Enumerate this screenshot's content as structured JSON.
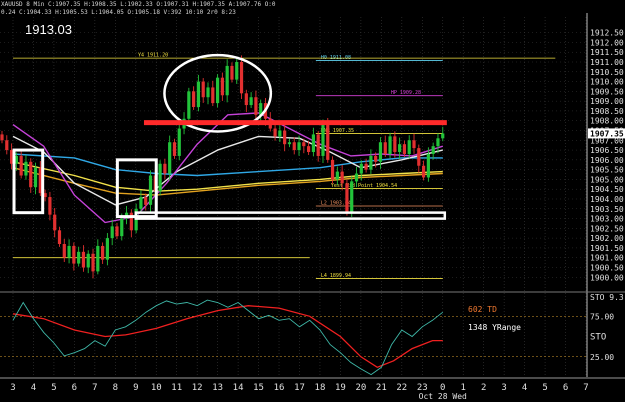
{
  "header": {
    "line1": "XAUUSD 8 Min C:1907.35 H:1908.35 L:1902.33 O:1907.31 H:1907.35 A:1907.76 O:0",
    "line2": "0.24 C:1904.33 H:1905.53 L:1904.05 O:1905.18 V:392 10:10 2r0 8:23"
  },
  "big_price": "1913.03",
  "theme": {
    "bg": "#000000",
    "grid": "#3a3a3a",
    "bull": "#22c33a",
    "bear": "#e23030",
    "axis_text": "#e0e0e0",
    "highlight_label": "#ffffff",
    "red_line": "#ff2a2a"
  },
  "chart_data": [
    {
      "type": "candlestick",
      "panel": "price",
      "ylim": [
        1899.4,
        1913.3
      ],
      "y_ticks": [
        "1912.50",
        "1912.00",
        "1911.50",
        "1911.00",
        "1910.50",
        "1910.00",
        "1909.50",
        "1909.00",
        "1908.50",
        "1908.00",
        "1907.50",
        "1907.00",
        "1906.50",
        "1906.00",
        "1905.50",
        "1905.00",
        "1904.50",
        "1904.00",
        "1903.50",
        "1903.00",
        "1902.50",
        "1902.00",
        "1901.50",
        "1901.00",
        "1900.50",
        "1900.00"
      ],
      "y_tick_values": [
        1912.5,
        1912,
        1911.5,
        1911,
        1910.5,
        1910,
        1909.5,
        1909,
        1908.5,
        1908,
        1907.5,
        1907,
        1906.5,
        1906,
        1905.5,
        1905,
        1904.5,
        1904,
        1903.5,
        1903,
        1902.5,
        1902,
        1901.5,
        1901,
        1900.5,
        1900
      ],
      "last_price": "1907.35",
      "x_ticks": [
        "3",
        "4",
        "5",
        "6",
        "7",
        "8",
        "9",
        "10",
        "11",
        "12",
        "13",
        "14",
        "15",
        "16",
        "17",
        "18",
        "19",
        "20",
        "21",
        "22",
        "23",
        "0",
        "1",
        "2",
        "3",
        "4",
        "5",
        "6",
        "7"
      ],
      "x_tick_values": [
        0,
        1,
        2,
        3,
        4,
        5,
        6,
        7,
        8,
        9,
        10,
        11,
        12,
        13,
        14,
        15,
        16,
        17,
        18,
        19,
        20,
        21,
        22,
        23,
        24,
        25,
        26,
        27,
        28
      ],
      "x_date_label": "Oct 28 Wed",
      "closes": [
        1907.0,
        1906.5,
        1905.8,
        1906.2,
        1905.2,
        1905.9,
        1904.6,
        1905.6,
        1904.3,
        1904.1,
        1903.2,
        1902.4,
        1901.7,
        1901.0,
        1901.6,
        1900.7,
        1901.3,
        1900.5,
        1901.2,
        1900.3,
        1901.6,
        1900.9,
        1902.0,
        1902.6,
        1902.1,
        1903.0,
        1903.3,
        1902.4,
        1903.5,
        1904.1,
        1903.7,
        1905.2,
        1904.4,
        1905.8,
        1905.3,
        1906.9,
        1906.2,
        1907.6,
        1908.1,
        1909.5,
        1908.7,
        1910.0,
        1909.2,
        1909.7,
        1908.9,
        1910.2,
        1909.3,
        1910.8,
        1910.1,
        1911.0,
        1909.4,
        1908.8,
        1909.2,
        1908.3,
        1908.9,
        1908.1,
        1907.6,
        1907.2,
        1907.5,
        1906.8,
        1906.9,
        1906.5,
        1906.9,
        1906.7,
        1906.4,
        1907.3,
        1906.2,
        1907.8,
        1906.0,
        1905.0,
        1905.4,
        1904.8,
        1903.3,
        1904.9,
        1905.3,
        1905.8,
        1905.5,
        1906.2,
        1905.9,
        1906.9,
        1906.3,
        1907.2,
        1906.4,
        1906.8,
        1906.3,
        1907.0,
        1906.6,
        1905.7,
        1905.1,
        1906.3,
        1906.7,
        1907.1,
        1907.35
      ],
      "lines": [
        {
          "name": "blue_ma",
          "color": "#2fa8e6",
          "points": [
            [
              0,
              1906.3
            ],
            [
              3,
              1906.1
            ],
            [
              5,
              1905.5
            ],
            [
              7,
              1905.3
            ],
            [
              9,
              1905.2
            ],
            [
              12,
              1905.4
            ],
            [
              15,
              1905.6
            ],
            [
              17,
              1905.9
            ],
            [
              19,
              1906.1
            ],
            [
              21,
              1906.1
            ]
          ]
        },
        {
          "name": "orange_ma",
          "color": "#e3a21f",
          "points": [
            [
              0,
              1905.6
            ],
            [
              3,
              1904.8
            ],
            [
              5,
              1904.3
            ],
            [
              7,
              1904.2
            ],
            [
              9,
              1904.4
            ],
            [
              12,
              1904.7
            ],
            [
              15,
              1904.9
            ],
            [
              17,
              1905.1
            ],
            [
              19,
              1905.2
            ],
            [
              21,
              1905.3
            ]
          ]
        },
        {
          "name": "yellow_ma",
          "color": "#f2e24a",
          "points": [
            [
              0,
              1905.9
            ],
            [
              3,
              1905.2
            ],
            [
              5,
              1904.6
            ],
            [
              7,
              1904.4
            ],
            [
              9,
              1904.5
            ],
            [
              12,
              1904.8
            ],
            [
              15,
              1905.0
            ],
            [
              17,
              1905.2
            ],
            [
              19,
              1905.3
            ],
            [
              21,
              1905.4
            ]
          ]
        },
        {
          "name": "white_ma",
          "color": "#e8e8e8",
          "points": [
            [
              0,
              1907.2
            ],
            [
              1.5,
              1906.4
            ],
            [
              3,
              1904.8
            ],
            [
              5,
              1903.7
            ],
            [
              6.5,
              1904.1
            ],
            [
              8,
              1905.4
            ],
            [
              10,
              1906.5
            ],
            [
              12,
              1907.2
            ],
            [
              14,
              1907.1
            ],
            [
              15.5,
              1906.4
            ],
            [
              17,
              1905.6
            ],
            [
              19,
              1906.0
            ],
            [
              21,
              1906.5
            ]
          ]
        },
        {
          "name": "magenta_ma",
          "color": "#c542d8",
          "points": [
            [
              0,
              1907.8
            ],
            [
              1.5,
              1906.7
            ],
            [
              3,
              1904.2
            ],
            [
              4.5,
              1902.8
            ],
            [
              6,
              1903.1
            ],
            [
              7.5,
              1904.8
            ],
            [
              9,
              1906.8
            ],
            [
              10.5,
              1908.3
            ],
            [
              12,
              1908.4
            ],
            [
              13.5,
              1907.6
            ],
            [
              15,
              1906.8
            ],
            [
              16.5,
              1906.2
            ],
            [
              18,
              1906.3
            ],
            [
              19.5,
              1906.2
            ],
            [
              21,
              1906.7
            ]
          ]
        }
      ],
      "levels": [
        {
          "label": "H0 1911.08",
          "value": 1911.08,
          "color": "#5fd2f0",
          "x_from": 14.8,
          "x_to": 21
        },
        {
          "label": "Y4 1911.20",
          "value": 1911.2,
          "color": "#f0e040",
          "x_from": 0,
          "x_to": 26.5
        },
        {
          "label": "HP 1909.28",
          "value": 1909.28,
          "color": "#d640d8",
          "x_from": 14.8,
          "x_to": 21
        },
        {
          "label": "RNR 1907.35",
          "value": 1907.35,
          "color": "#f0e040",
          "x_from": 14.8,
          "x_to": 21
        },
        {
          "label": "Yest Mid Point 1904.54",
          "value": 1904.54,
          "color": "#f0e040",
          "x_from": 14.8,
          "x_to": 21
        },
        {
          "label": "L2 1903.64",
          "value": 1903.64,
          "color": "#f09060",
          "x_from": 14.8,
          "x_to": 21
        },
        {
          "label": "",
          "value": 1901.0,
          "color": "#f0e040",
          "x_from": 0,
          "x_to": 14.5
        },
        {
          "label": "L4 1899.94",
          "value": 1899.94,
          "color": "#f0e040",
          "x_from": 14.8,
          "x_to": 21
        }
      ]
    },
    {
      "type": "line",
      "panel": "oscillator",
      "ylim": [
        0,
        100
      ],
      "y_ticks": [
        "STO 9.3",
        "25.00",
        "75.00"
      ],
      "y_tick_values": [
        100,
        25,
        75
      ],
      "labels": [
        "602 TD",
        "1348 YRange"
      ],
      "side_label": "STO",
      "series": [
        {
          "name": "",
          "color": "#f02020",
          "points": [
            [
              0,
              78
            ],
            [
              1.5,
              72
            ],
            [
              3,
              58
            ],
            [
              4.5,
              50
            ],
            [
              5.5,
              52
            ],
            [
              7,
              60
            ],
            [
              8.5,
              72
            ],
            [
              10,
              82
            ],
            [
              11.5,
              88
            ],
            [
              13,
              85
            ],
            [
              14.5,
              75
            ],
            [
              16,
              50
            ],
            [
              17,
              25
            ],
            [
              17.8,
              12
            ],
            [
              18.6,
              20
            ],
            [
              19.5,
              35
            ],
            [
              20.5,
              45
            ],
            [
              21,
              45
            ]
          ]
        },
        {
          "name": "",
          "color": "#3fb8a8",
          "points": [
            [
              0,
              70
            ],
            [
              0.5,
              92
            ],
            [
              1,
              72
            ],
            [
              1.5,
              55
            ],
            [
              2,
              42
            ],
            [
              2.5,
              26
            ],
            [
              3,
              30
            ],
            [
              3.5,
              35
            ],
            [
              4,
              45
            ],
            [
              4.5,
              38
            ],
            [
              5,
              58
            ],
            [
              5.5,
              62
            ],
            [
              6,
              70
            ],
            [
              6.5,
              80
            ],
            [
              7,
              88
            ],
            [
              7.5,
              94
            ],
            [
              8,
              90
            ],
            [
              8.5,
              92
            ],
            [
              9,
              88
            ],
            [
              9.5,
              95
            ],
            [
              10,
              92
            ],
            [
              10.5,
              86
            ],
            [
              11,
              92
            ],
            [
              11.5,
              82
            ],
            [
              12,
              72
            ],
            [
              12.5,
              76
            ],
            [
              13,
              70
            ],
            [
              13.5,
              72
            ],
            [
              14,
              62
            ],
            [
              14.5,
              70
            ],
            [
              15,
              58
            ],
            [
              15.5,
              40
            ],
            [
              16,
              30
            ],
            [
              16.5,
              18
            ],
            [
              17,
              10
            ],
            [
              17.5,
              3
            ],
            [
              18,
              12
            ],
            [
              18.5,
              40
            ],
            [
              19,
              58
            ],
            [
              19.5,
              50
            ],
            [
              20,
              62
            ],
            [
              20.5,
              70
            ],
            [
              21,
              80
            ]
          ]
        }
      ]
    }
  ]
}
